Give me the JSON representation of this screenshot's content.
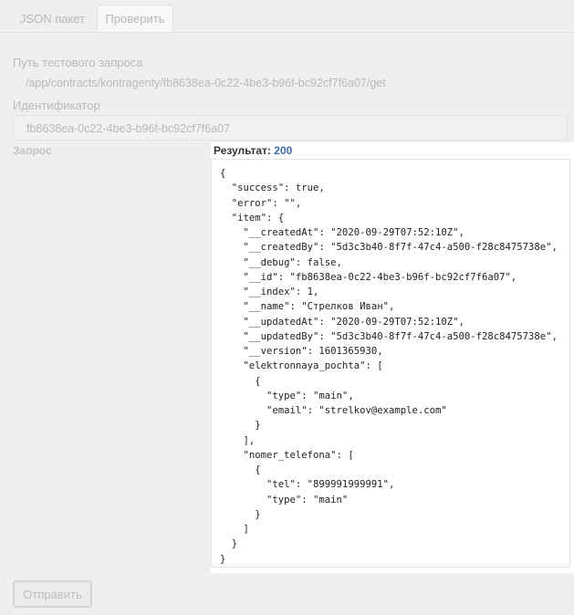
{
  "tabs": [
    {
      "label": "JSON пакет"
    },
    {
      "label": "Проверить"
    }
  ],
  "form": {
    "path_label": "Путь тестового запроса",
    "path_value": "/app/contracts/kontragenty/fb8638ea-0c22-4be3-b96f-bc92cf7f6a07/get",
    "id_label": "Идентификатор",
    "id_value": "fb8638ea-0c22-4be3-b96f-bc92cf7f6a07",
    "request_label": "Запрос"
  },
  "result": {
    "label": "Результат:",
    "status_code": "200",
    "response_text": "{\n  \"success\": true,\n  \"error\": \"\",\n  \"item\": {\n    \"__createdAt\": \"2020-09-29T07:52:10Z\",\n    \"__createdBy\": \"5d3c3b40-8f7f-47c4-a500-f28c8475738e\",\n    \"__debug\": false,\n    \"__id\": \"fb8638ea-0c22-4be3-b96f-bc92cf7f6a07\",\n    \"__index\": 1,\n    \"__name\": \"Стрелков Иван\",\n    \"__updatedAt\": \"2020-09-29T07:52:10Z\",\n    \"__updatedBy\": \"5d3c3b40-8f7f-47c4-a500-f28c8475738e\",\n    \"__version\": 1601365930,\n    \"elektronnaya_pochta\": [\n      {\n        \"type\": \"main\",\n        \"email\": \"strelkov@example.com\"\n      }\n    ],\n    \"nomer_telefona\": [\n      {\n        \"tel\": \"899991999991\",\n        \"type\": \"main\"\n      }\n    ]\n  }\n}"
  },
  "actions": {
    "send_label": "Отправить"
  },
  "colors": {
    "page_background": "#efefef",
    "status_code": "#3a6aa8"
  }
}
